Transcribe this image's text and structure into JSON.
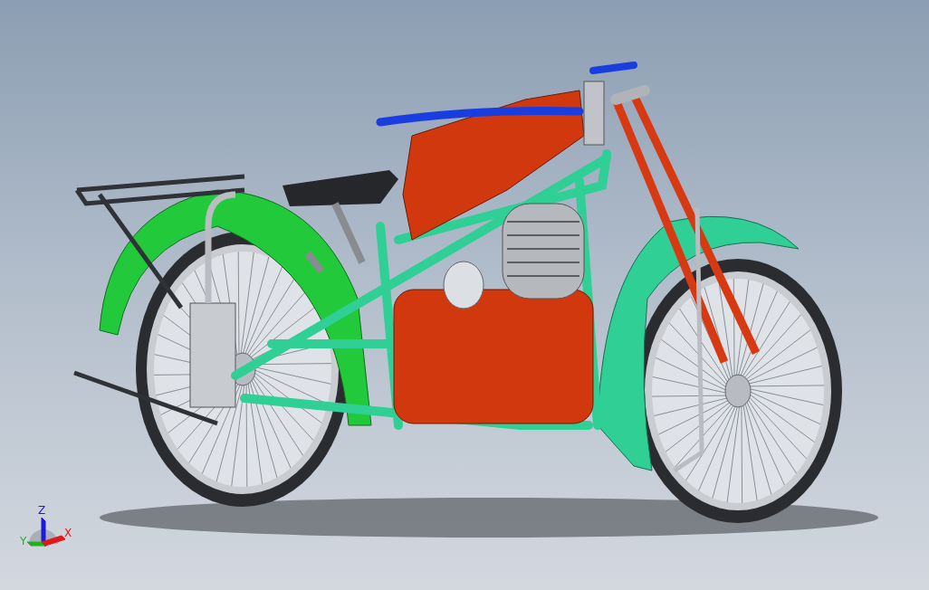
{
  "viewport": {
    "triad": {
      "axes": [
        {
          "kind": "z",
          "label": "Z",
          "color": "#1a1ad8"
        },
        {
          "kind": "y",
          "label": "Y",
          "color": "#22b022"
        },
        {
          "kind": "x",
          "label": "X",
          "color": "#e01818"
        }
      ]
    }
  }
}
